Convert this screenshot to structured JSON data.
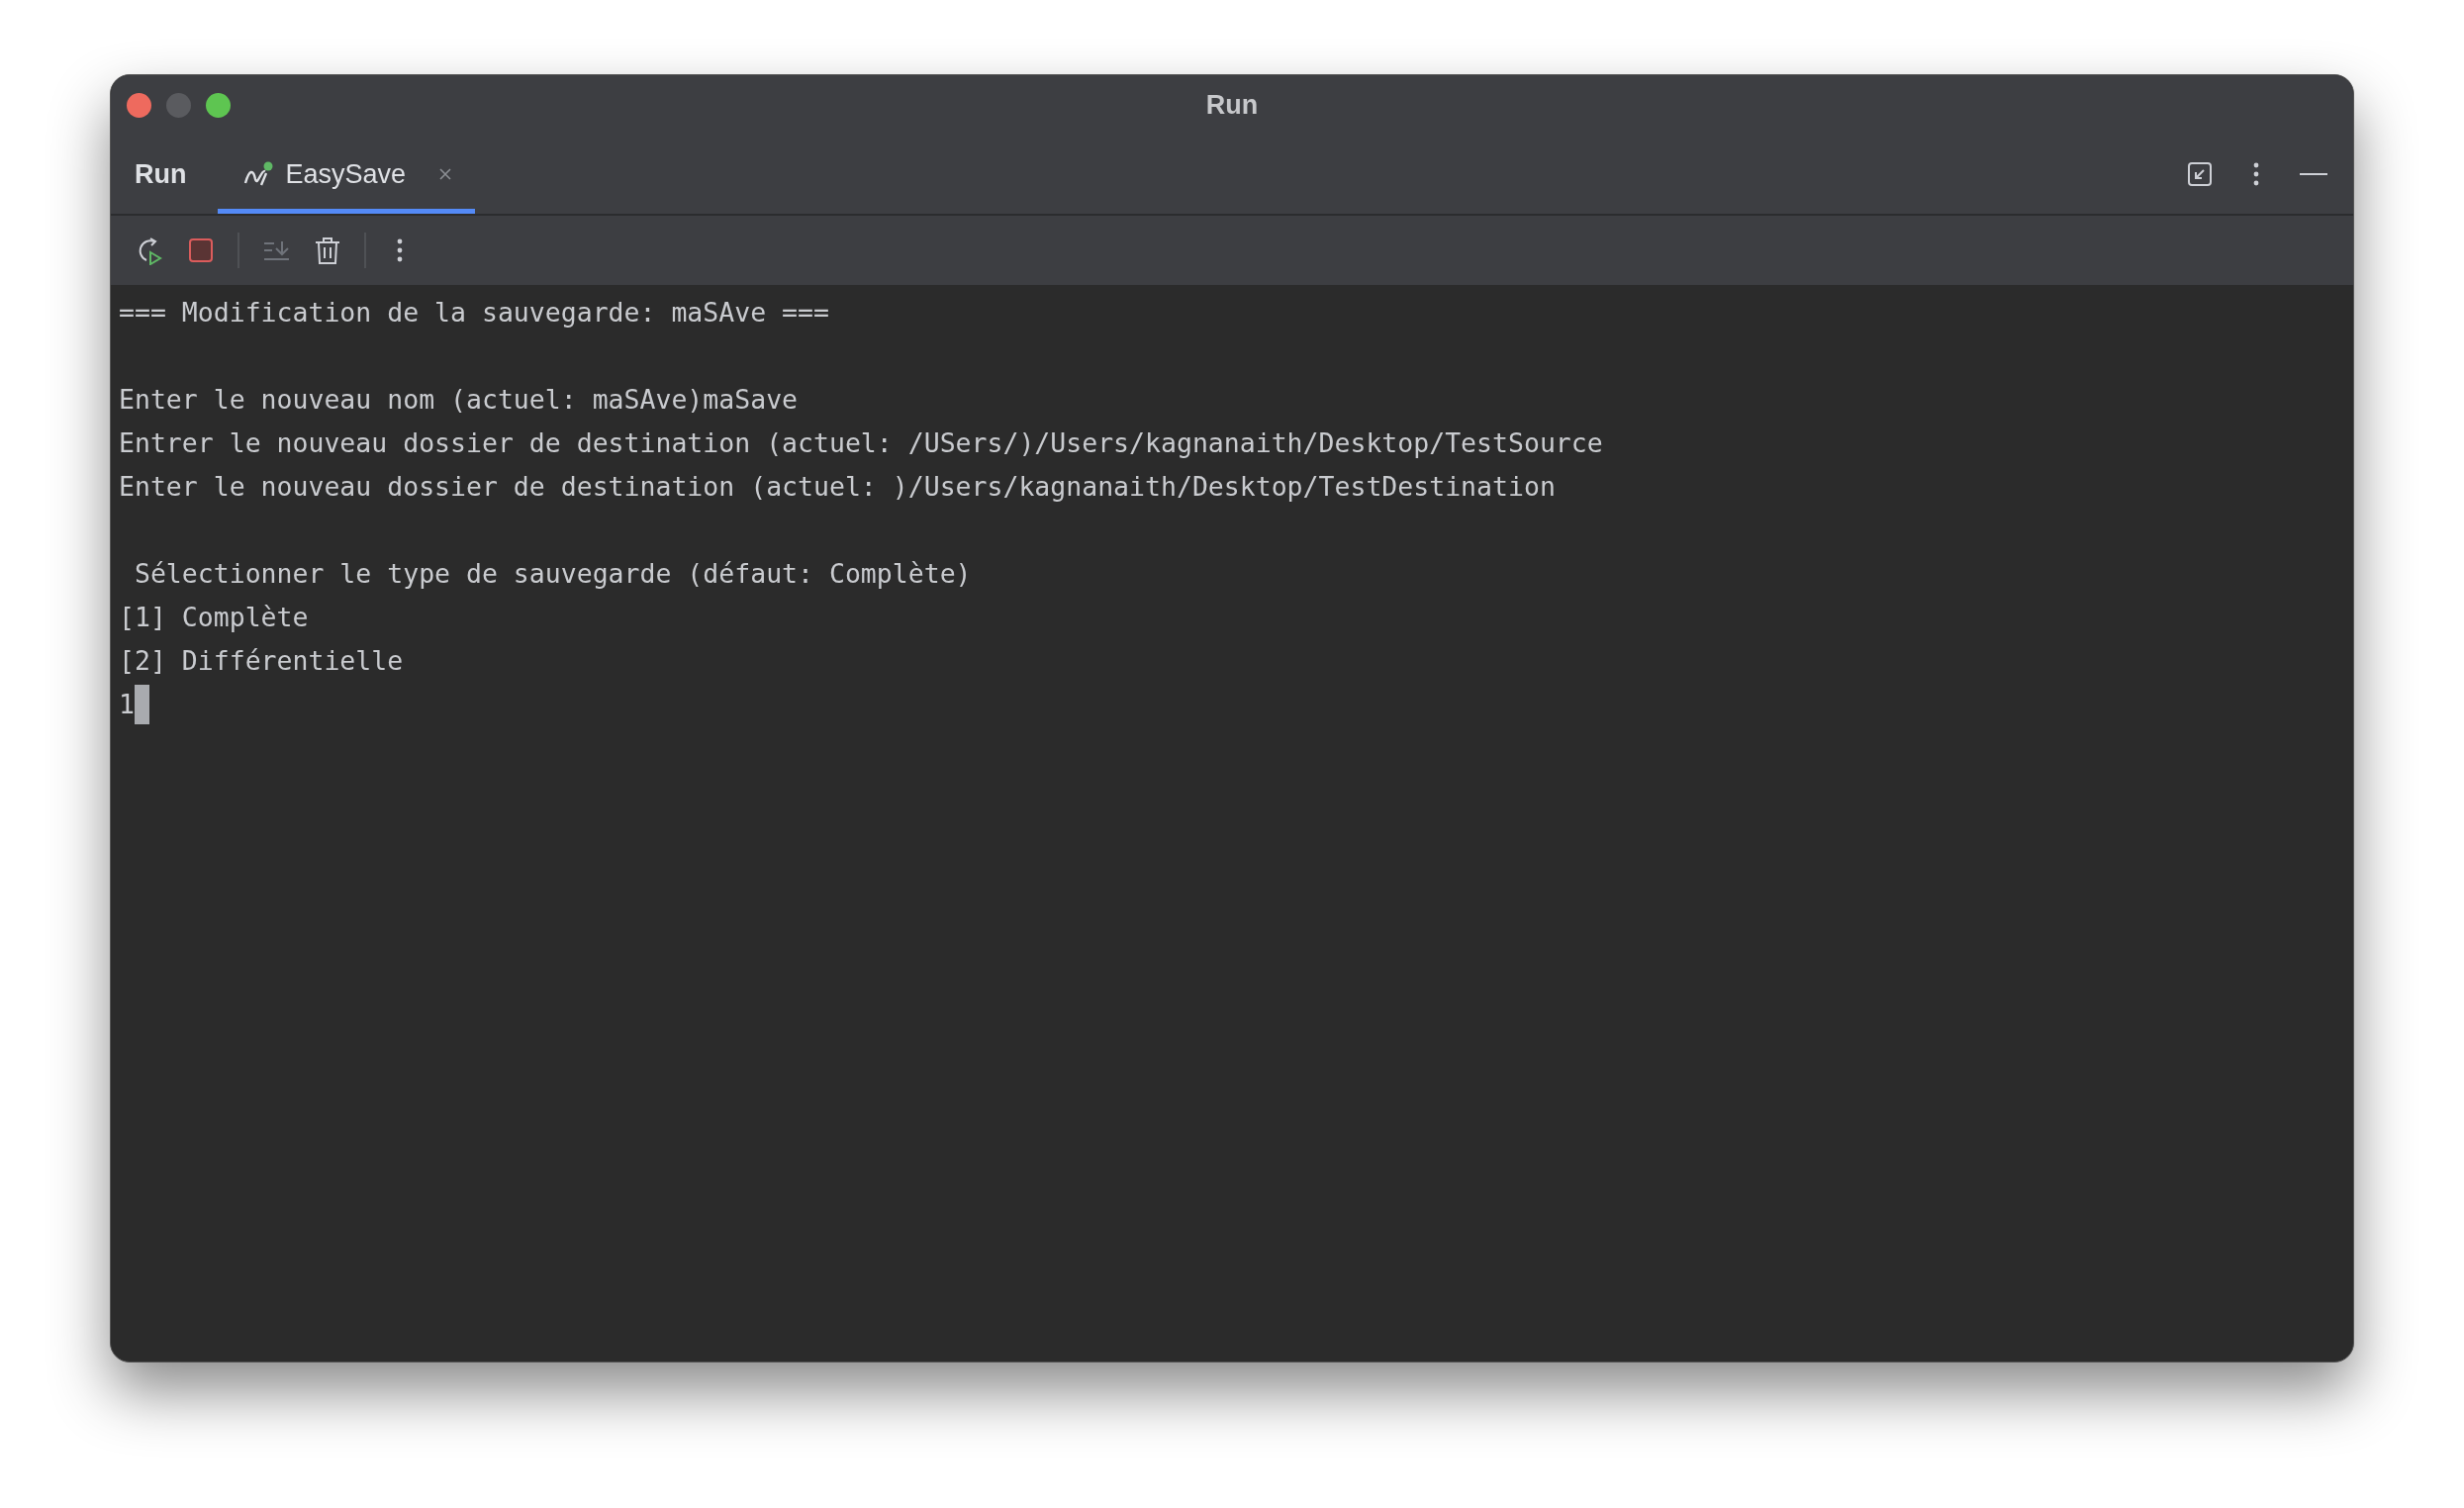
{
  "window": {
    "title": "Run"
  },
  "tool_window": {
    "title": "Run"
  },
  "tabs": [
    {
      "label": "EasySave",
      "selected": true,
      "running": true
    }
  ],
  "console": {
    "blocks": [
      [
        "=== Modification de la sauvegarde: maSAve ==="
      ],
      [
        "Enter le nouveau nom (actuel: maSAve)maSave",
        "Entrer le nouveau dossier de destination (actuel: /USers/)/Users/kagnanaith/Desktop/TestSource",
        "Enter le nouveau dossier de destination (actuel: )/Users/kagnanaith/Desktop/TestDestination"
      ],
      [
        " Sélectionner le type de sauvegarde (défaut: Complète)",
        "[1] Complète",
        "[2] Différentielle"
      ]
    ],
    "input": "1"
  }
}
